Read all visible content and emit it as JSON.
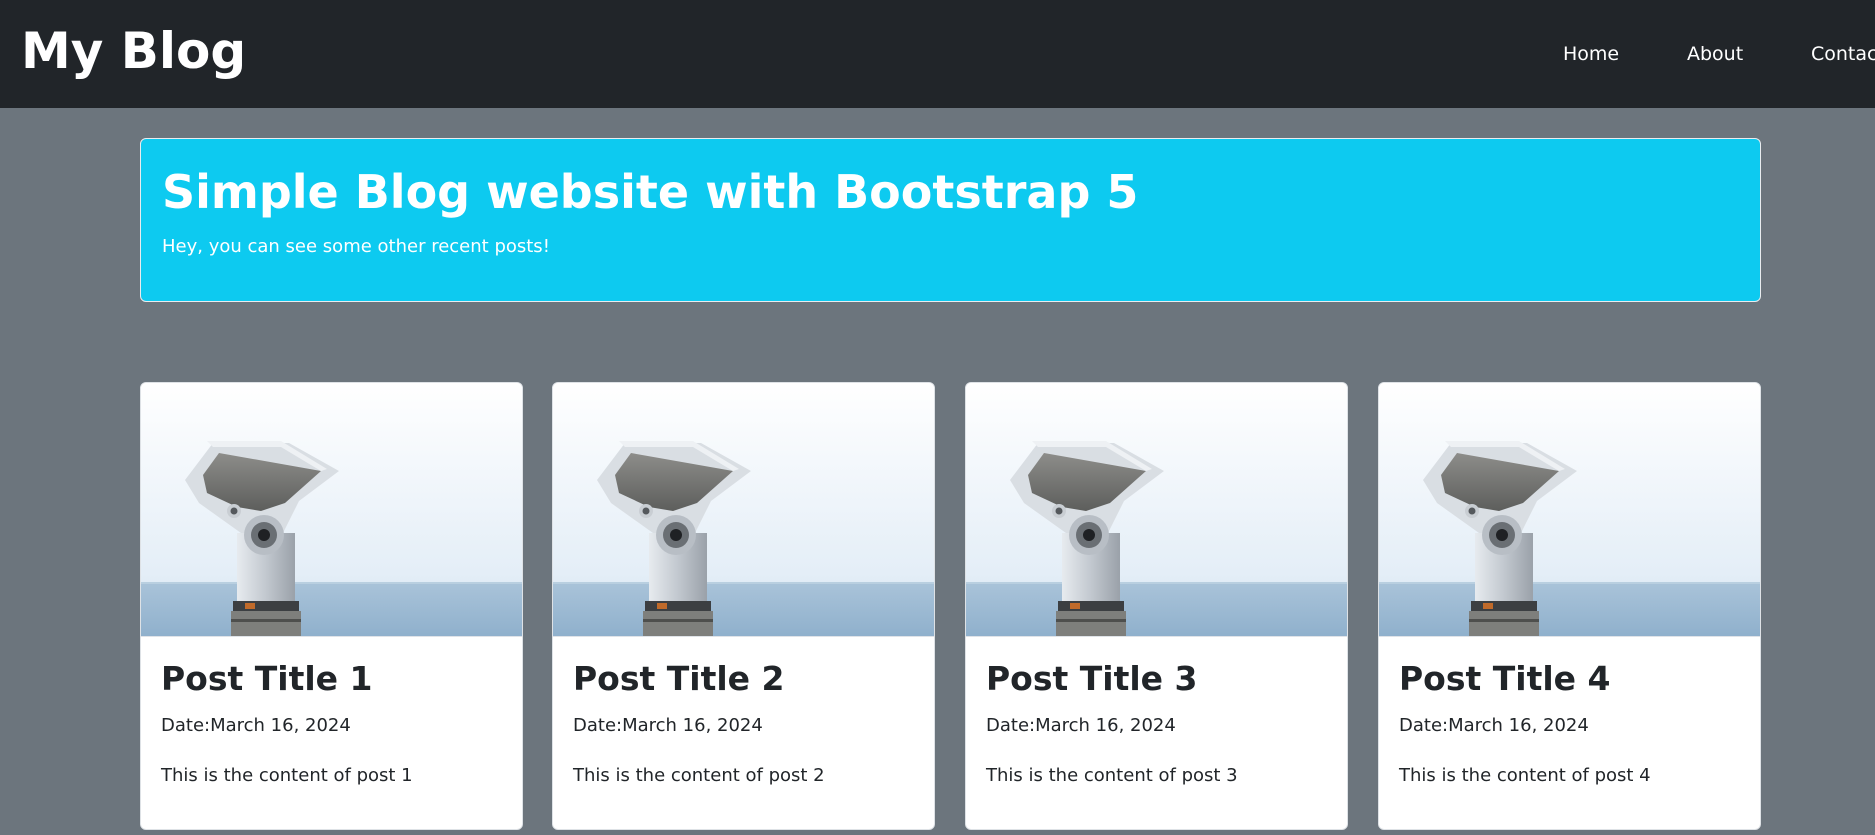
{
  "navbar": {
    "brand": "My Blog",
    "links": [
      "Home",
      "About",
      "Contact"
    ]
  },
  "hero": {
    "title": "Simple Blog website with Bootstrap 5",
    "subtitle": "Hey, you can see some other recent posts!"
  },
  "posts": [
    {
      "title": "Post Title 1",
      "date": "Date:March 16, 2024",
      "content": "This is the content of post 1"
    },
    {
      "title": "Post Title 2",
      "date": "Date:March 16, 2024",
      "content": "This is the content of post 2"
    },
    {
      "title": "Post Title 3",
      "date": "Date:March 16, 2024",
      "content": "This is the content of post 3"
    },
    {
      "title": "Post Title 4",
      "date": "Date:March 16, 2024",
      "content": "This is the content of post 4"
    }
  ],
  "colors": {
    "navbar_bg": "#212529",
    "page_bg": "#6c757d",
    "hero_bg": "#0dcaf0",
    "card_bg": "#ffffff"
  },
  "icons": {
    "post_image": "coin-operated-binoculars-photo"
  }
}
